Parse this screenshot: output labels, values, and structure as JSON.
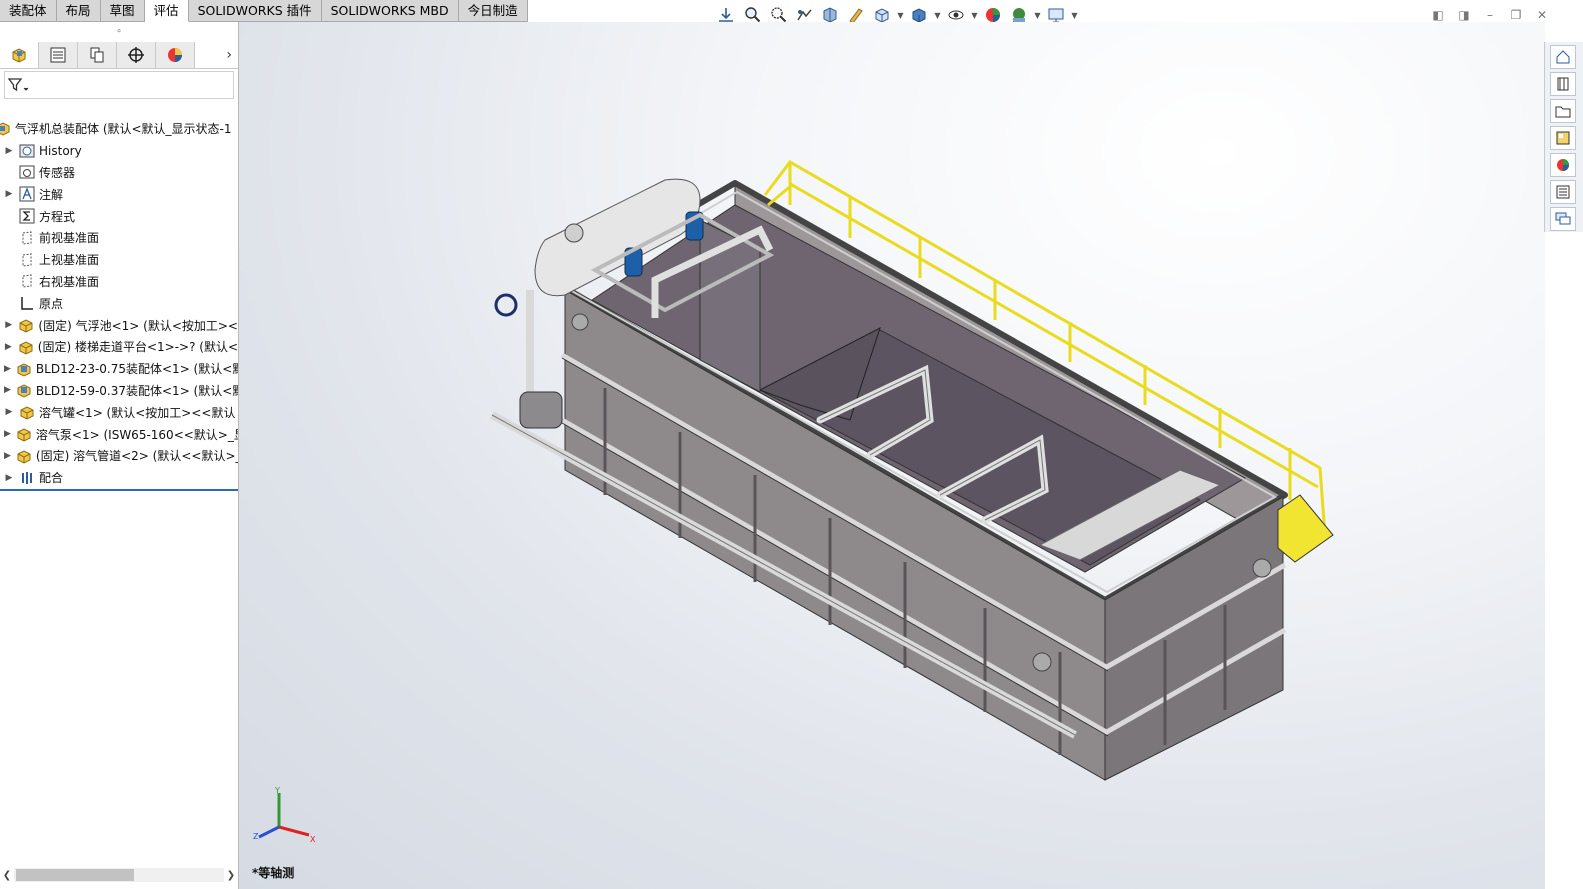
{
  "tabs": [
    "装配体",
    "布局",
    "草图",
    "评估",
    "SOLIDWORKS 插件",
    "SOLIDWORKS MBD",
    "今日制造"
  ],
  "active_tab_index": 3,
  "hud_icons": [
    "view-normal-icon",
    "zoom-to-fit-icon",
    "zoom-area-icon",
    "previous-view-icon",
    "section-view-icon",
    "dynamic-annotation-icon",
    "view-orientation-icon",
    "display-style-icon",
    "hide-show-icon",
    "edit-appearance-icon",
    "apply-scene-icon",
    "view-settings-icon"
  ],
  "tree": {
    "root_label": "气浮机总装配体  (默认<默认_显示状态-1",
    "items": [
      {
        "label": "History",
        "icon": "history-icon",
        "expandable": true
      },
      {
        "label": "传感器",
        "icon": "sensor-icon",
        "expandable": false
      },
      {
        "label": "注解",
        "icon": "annotation-icon",
        "expandable": true
      },
      {
        "label": "方程式",
        "icon": "equation-icon",
        "expandable": false
      },
      {
        "label": "前视基准面",
        "icon": "plane-icon",
        "expandable": false
      },
      {
        "label": "上视基准面",
        "icon": "plane-icon",
        "expandable": false
      },
      {
        "label": "右视基准面",
        "icon": "plane-icon",
        "expandable": false
      },
      {
        "label": "原点",
        "icon": "origin-icon",
        "expandable": false
      },
      {
        "label": "(固定) 气浮池<1> (默认<按加工><",
        "icon": "part-icon",
        "expandable": true
      },
      {
        "label": "(固定) 楼梯走道平台<1>->? (默认<",
        "icon": "part-icon",
        "expandable": true
      },
      {
        "label": "BLD12-23-0.75装配体<1> (默认<默",
        "icon": "assembly-icon",
        "expandable": true
      },
      {
        "label": "BLD12-59-0.37装配体<1> (默认<默",
        "icon": "assembly-icon",
        "expandable": true
      },
      {
        "label": "溶气罐<1> (默认<按加工><<默认",
        "icon": "part-icon",
        "expandable": true
      },
      {
        "label": "溶气泵<1> (ISW65-160<<默认>_显",
        "icon": "part-icon",
        "expandable": true
      },
      {
        "label": "(固定) 溶气管道<2> (默认<<默认>_",
        "icon": "part-icon",
        "expandable": true
      },
      {
        "label": "配合",
        "icon": "mates-icon",
        "expandable": true
      }
    ]
  },
  "viewport": {
    "view_name": "*等轴测",
    "triad_axes": [
      "X",
      "Y",
      "Z"
    ]
  },
  "colors": {
    "tab_active": "#ffffff",
    "tab_inactive": "#d7d7d7",
    "tank": "#8e8a8c",
    "tank_inner": "#6f6570",
    "railing": "#f2e532",
    "motor": "#1d5fa8"
  }
}
